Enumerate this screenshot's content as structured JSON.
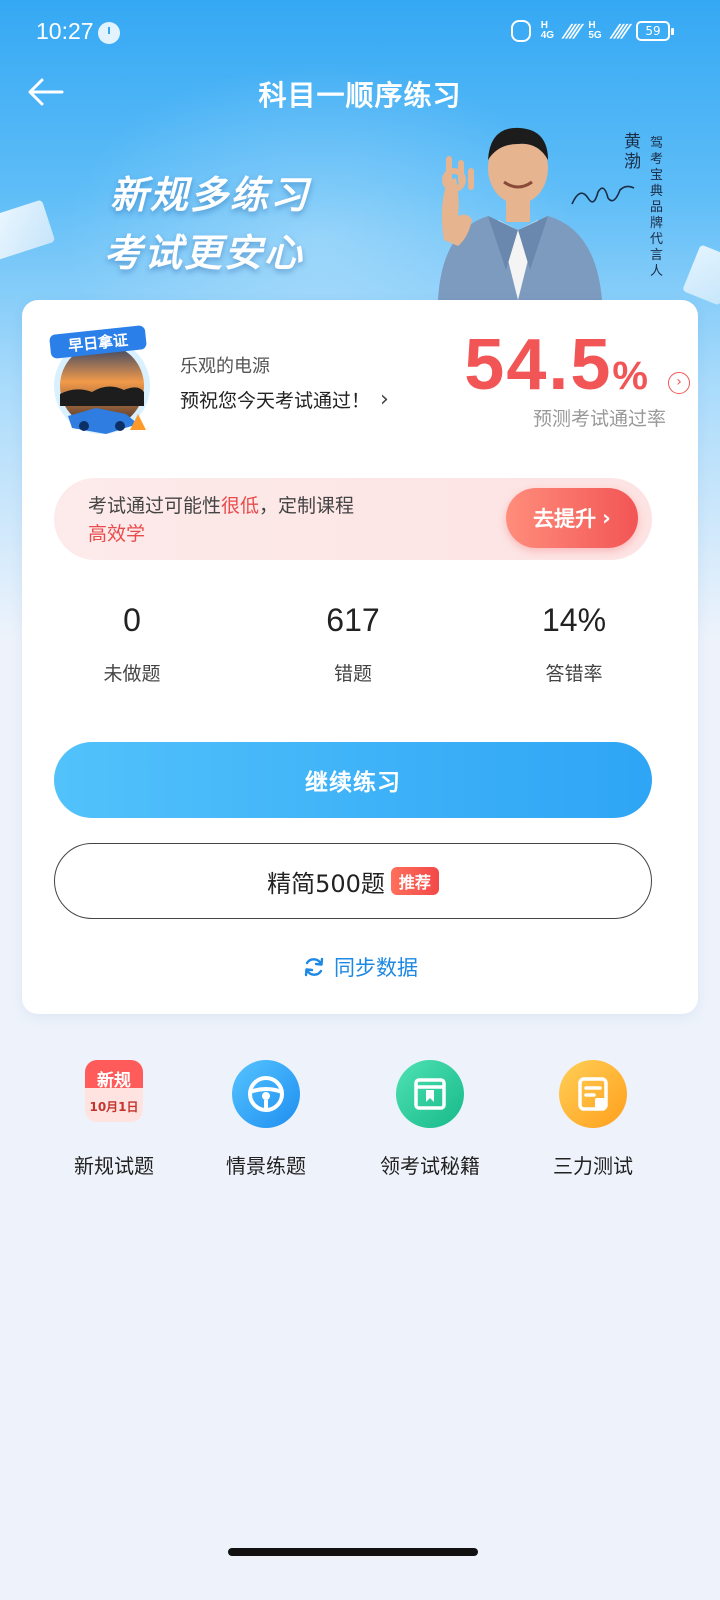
{
  "status_bar": {
    "time": "10:27",
    "network1": "4G",
    "network2": "5G",
    "battery": "59"
  },
  "nav": {
    "title": "科目一顺序练习"
  },
  "banner": {
    "slogan_line1": "新规多练习",
    "slogan_line2": "考试更安心",
    "spokesperson_name": "黄渤",
    "spokesperson_title": "驾考宝典品牌代言人"
  },
  "card": {
    "badge_text": "早日拿证",
    "user_name": "乐观的电源",
    "wish": "预祝您今天考试通过！",
    "pass_rate_number": "54.5",
    "pass_rate_unit": "%",
    "pass_rate_label": "预测考试通过率",
    "tip": {
      "prefix": "考试通过可能性",
      "highlight": "很低",
      "suffix": "，定制课程",
      "line2": "高效学",
      "button": "去提升"
    },
    "stats": [
      {
        "value": "0",
        "label": "未做题"
      },
      {
        "value": "617",
        "label": "错题"
      },
      {
        "value": "14%",
        "label": "答错率"
      }
    ],
    "continue_button": "继续练习",
    "simplified_button": "精简500题",
    "simplified_tag": "推荐",
    "sync_label": "同步数据"
  },
  "tools": [
    {
      "label": "新规试题",
      "icon": "new-rules-calendar-icon",
      "icon_text1": "新规",
      "icon_text2": "10月1日"
    },
    {
      "label": "情景练题",
      "icon": "steering-wheel-icon"
    },
    {
      "label": "领考试秘籍",
      "icon": "book-icon"
    },
    {
      "label": "三力测试",
      "icon": "note-icon"
    }
  ],
  "colors": {
    "primary_blue": "#2ea5f5",
    "accent_red": "#f25555",
    "sync_blue": "#1e88e5"
  }
}
